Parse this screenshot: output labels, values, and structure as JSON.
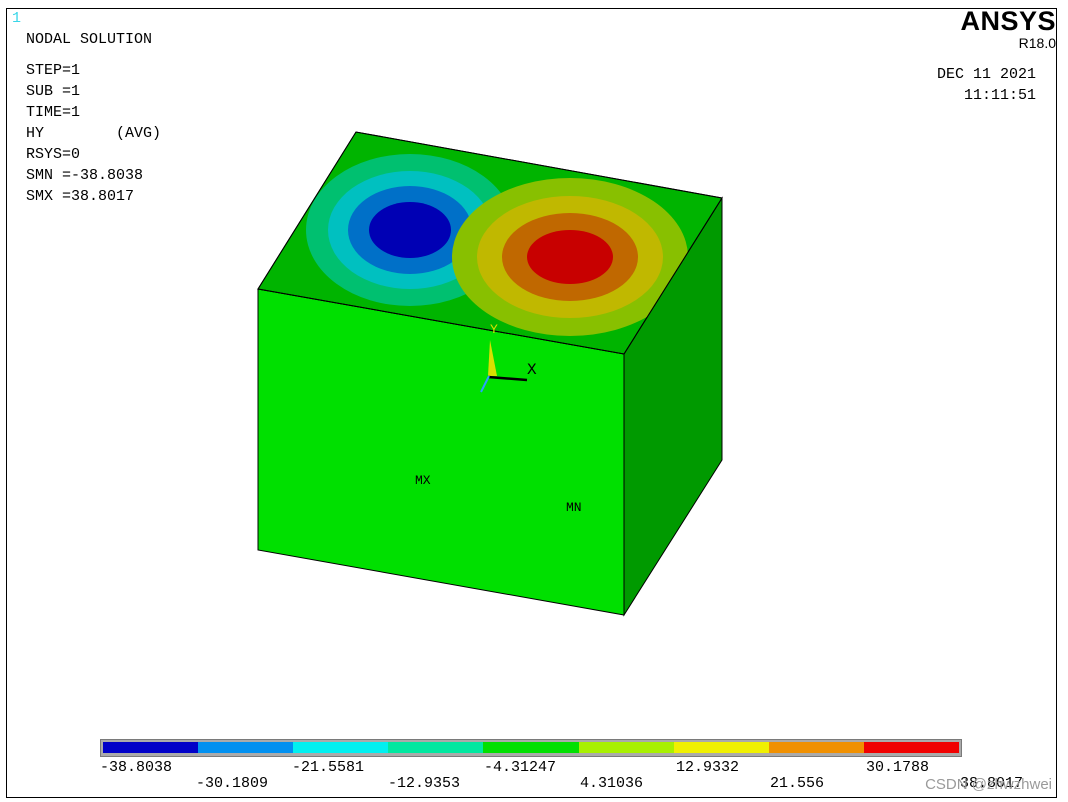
{
  "window_number": "1",
  "header": {
    "title": "NODAL SOLUTION",
    "info_lines": [
      "STEP=1",
      "SUB =1",
      "TIME=1",
      "HY        (AVG)",
      "RSYS=0",
      "SMN =-38.8038",
      "SMX =38.8017"
    ]
  },
  "logo": {
    "brand": "ANSYS",
    "version": "R18.0"
  },
  "datetime": {
    "date": "DEC 11 2021",
    "time": "11:11:51"
  },
  "triad": {
    "y_label": "Y",
    "x_label": "X"
  },
  "markers": {
    "max_label": "MX",
    "min_label": "MN"
  },
  "legend": {
    "colors": [
      "#0000c8",
      "#0090f0",
      "#00f0f0",
      "#00e8a0",
      "#00e000",
      "#a8f000",
      "#f0f000",
      "#f09000",
      "#f00000"
    ],
    "top_labels": [
      "-38.8038",
      "-21.5581",
      "-4.31247",
      "12.9332",
      "30.1788"
    ],
    "bottom_labels": [
      "-30.1809",
      "-12.9353",
      "4.31036",
      "21.556",
      "38.8017"
    ]
  },
  "scene_colors": {
    "front_face": "#00e000",
    "top_face": "#00b400",
    "side_face": "#009a00",
    "edge": "#000000"
  },
  "watermark": "CSDN @zhwzhwei"
}
